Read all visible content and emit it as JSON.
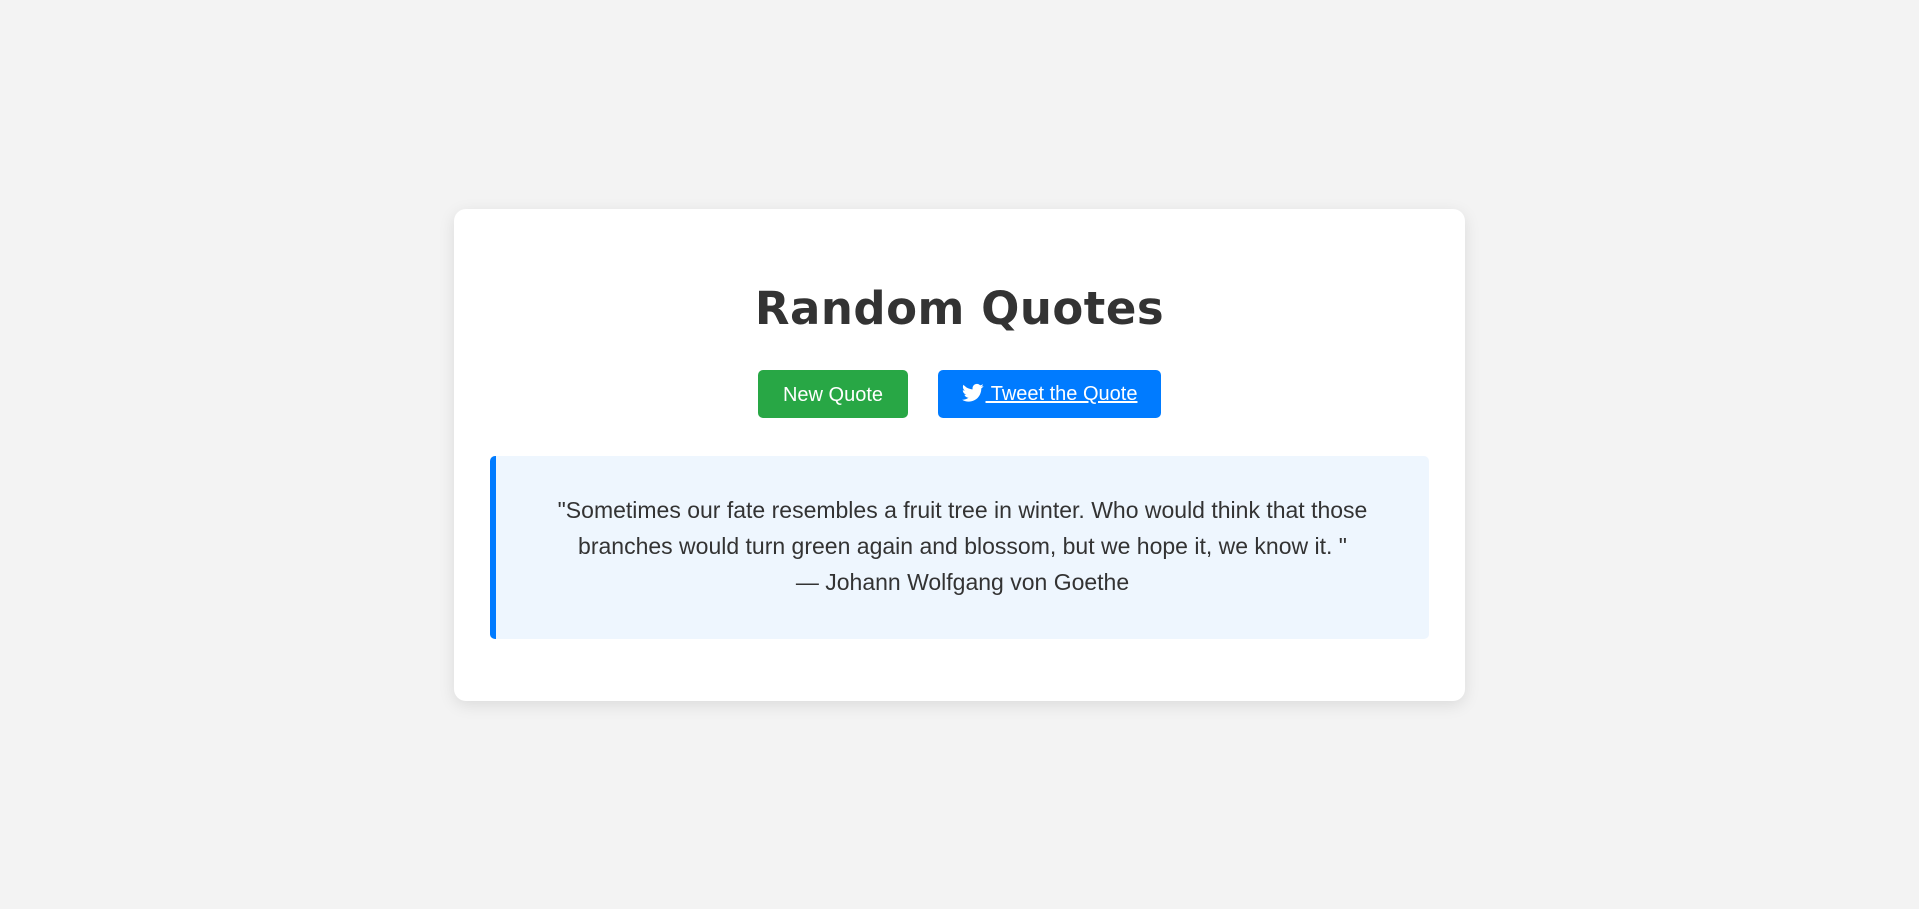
{
  "app": {
    "title": "Random Quotes"
  },
  "buttons": {
    "new_quote_label": "New Quote",
    "tweet_label": " Tweet the Quote",
    "tweet_icon": "twitter-icon"
  },
  "quote": {
    "text": "\"Sometimes our fate resembles a fruit tree in winter. Who would think that those branches would turn green again and blossom, but we hope it, we know it. \"",
    "author": "— Johann Wolfgang von Goethe"
  },
  "colors": {
    "background": "#f3f3f3",
    "new_quote_button": "#28a745",
    "tweet_button": "#007bff",
    "quote_background": "#eef6fe",
    "quote_border": "#007bff",
    "text": "#333333"
  }
}
